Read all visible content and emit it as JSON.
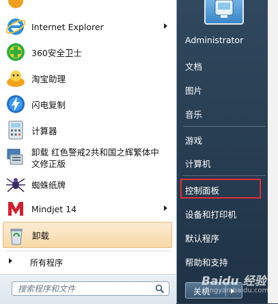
{
  "left_items": [
    {
      "label": "Internet Explorer",
      "icon": "internet-explorer-icon",
      "has_submenu": true
    },
    {
      "label": "360安全卫士",
      "icon": "360-security-icon",
      "has_submenu": false
    },
    {
      "label": "淘宝助理",
      "icon": "taobao-assistant-icon",
      "has_submenu": false
    },
    {
      "label": "闪电复制",
      "icon": "lightning-copy-icon",
      "has_submenu": false
    },
    {
      "label": "计算器",
      "icon": "calculator-icon",
      "has_submenu": false
    },
    {
      "label_line1": "卸载 红色警戒2共和国之辉繁体中",
      "label_line2": "文修正版",
      "icon": "uninstall-ra2-icon",
      "has_submenu": false
    },
    {
      "label": "蜘蛛纸牌",
      "icon": "spider-solitaire-icon",
      "has_submenu": false
    },
    {
      "label": "Mindjet 14",
      "icon": "mindjet-icon",
      "has_submenu": true
    },
    {
      "label": "卸载",
      "icon": "recycle-bin-icon",
      "has_submenu": false
    }
  ],
  "all_programs": "所有程序",
  "search": {
    "placeholder": "搜索程序和文件"
  },
  "right_items": [
    {
      "label": "Administrator"
    },
    {
      "label": "文档"
    },
    {
      "label": "图片"
    },
    {
      "label": "音乐"
    },
    {
      "label": "游戏"
    },
    {
      "label": "计算机"
    },
    {
      "label": "控制面板"
    },
    {
      "label": "设备和打印机"
    },
    {
      "label": "默认程序"
    },
    {
      "label": "帮助和支持"
    }
  ],
  "shutdown_label": "关机",
  "watermark": {
    "line1": "Baidu 经验",
    "line2": "jingyan.baidu.com"
  },
  "colors": {
    "highlight_border": "#e0303a",
    "menu_bg": "#30485e"
  }
}
